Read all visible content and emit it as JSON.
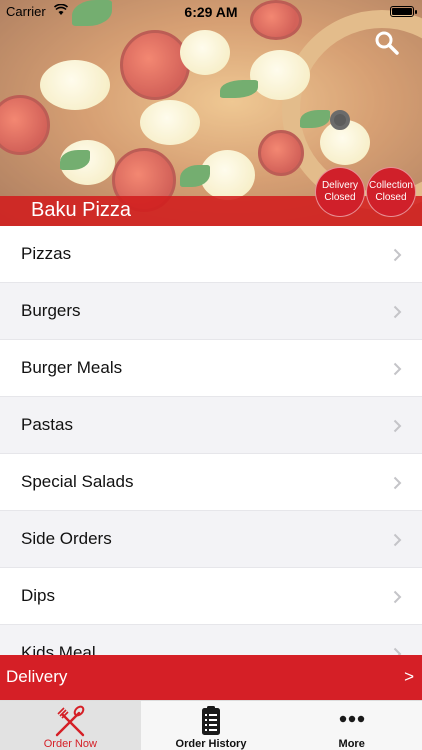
{
  "status_bar": {
    "carrier": "Carrier",
    "time": "6:29 AM"
  },
  "header": {
    "restaurant_name": "Baku Pizza",
    "badges": [
      {
        "line1": "Delivery",
        "line2": "Closed"
      },
      {
        "line1": "Collection",
        "line2": "Closed"
      }
    ]
  },
  "menu": {
    "items": [
      {
        "label": "Pizzas"
      },
      {
        "label": "Burgers"
      },
      {
        "label": "Burger Meals"
      },
      {
        "label": "Pastas"
      },
      {
        "label": "Special Salads"
      },
      {
        "label": "Side Orders"
      },
      {
        "label": "Dips"
      },
      {
        "label": "Kids Meal"
      }
    ]
  },
  "delivery_bar": {
    "label": "Delivery",
    "arrow": ">"
  },
  "tabs": [
    {
      "label": "Order Now",
      "icon": "fork-knife-icon",
      "active": true
    },
    {
      "label": "Order History",
      "icon": "clipboard-list-icon",
      "active": false
    },
    {
      "label": "More",
      "icon": "more-dots-icon",
      "active": false
    }
  ],
  "colors": {
    "accent": "#d51f26",
    "row_alt": "#f3f3f6"
  }
}
